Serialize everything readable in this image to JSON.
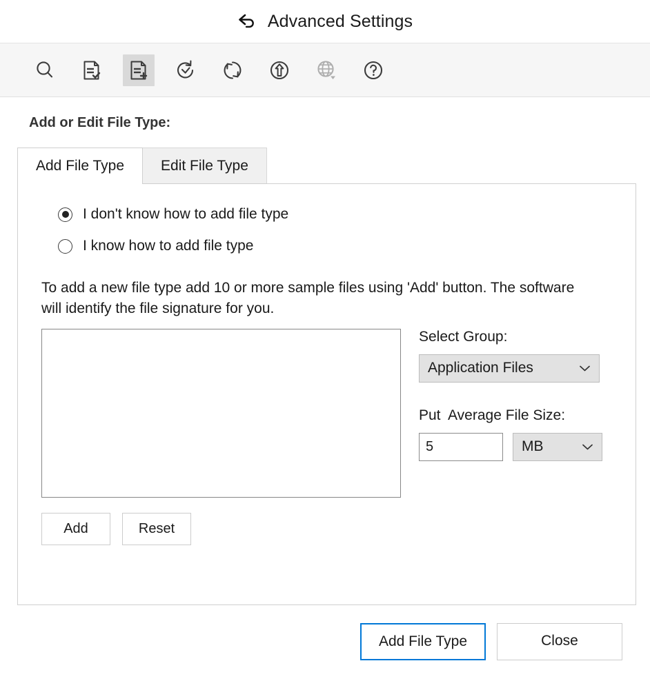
{
  "window": {
    "title": "Advanced Settings",
    "back_icon": "back-arrow-icon"
  },
  "toolbar": {
    "items": [
      {
        "icon": "search-icon",
        "active": false,
        "disabled": false
      },
      {
        "icon": "document-check-icon",
        "active": false,
        "disabled": false
      },
      {
        "icon": "document-add-icon",
        "active": true,
        "disabled": false
      },
      {
        "icon": "clock-history-icon",
        "active": false,
        "disabled": false
      },
      {
        "icon": "refresh-icon",
        "active": false,
        "disabled": false
      },
      {
        "icon": "upload-circle-icon",
        "active": false,
        "disabled": false
      },
      {
        "icon": "globe-dropdown-icon",
        "active": false,
        "disabled": true
      },
      {
        "icon": "help-question-icon",
        "active": false,
        "disabled": false
      }
    ]
  },
  "main": {
    "section_title": "Add or Edit File Type:",
    "tabs": [
      {
        "label": "Add File Type",
        "active": true
      },
      {
        "label": "Edit File Type",
        "active": false
      }
    ],
    "radios": [
      {
        "label": "I don't know how to add file type",
        "checked": true
      },
      {
        "label": "I know how to add file type",
        "checked": false
      }
    ],
    "instructions": "To add a new file type add 10 or more sample files using 'Add' button. The software will identify the file signature for you.",
    "file_list": {
      "items": [],
      "placeholder": ""
    },
    "list_buttons": [
      {
        "label": "Add"
      },
      {
        "label": "Reset"
      }
    ],
    "select_group": {
      "label": "Select Group:",
      "value": "Application Files"
    },
    "average_file_size": {
      "label": "Put  Average File Size:",
      "value": "5",
      "unit": "MB"
    }
  },
  "footer": {
    "primary_label": "Add File Type",
    "close_label": "Close"
  },
  "colors": {
    "accent": "#0078d7",
    "toolbar_bg": "#f6f6f6",
    "active_tool_bg": "#d9d9d9",
    "dropdown_bg": "#e2e2e2",
    "inactive_tab_bg": "#f0f0f0"
  }
}
